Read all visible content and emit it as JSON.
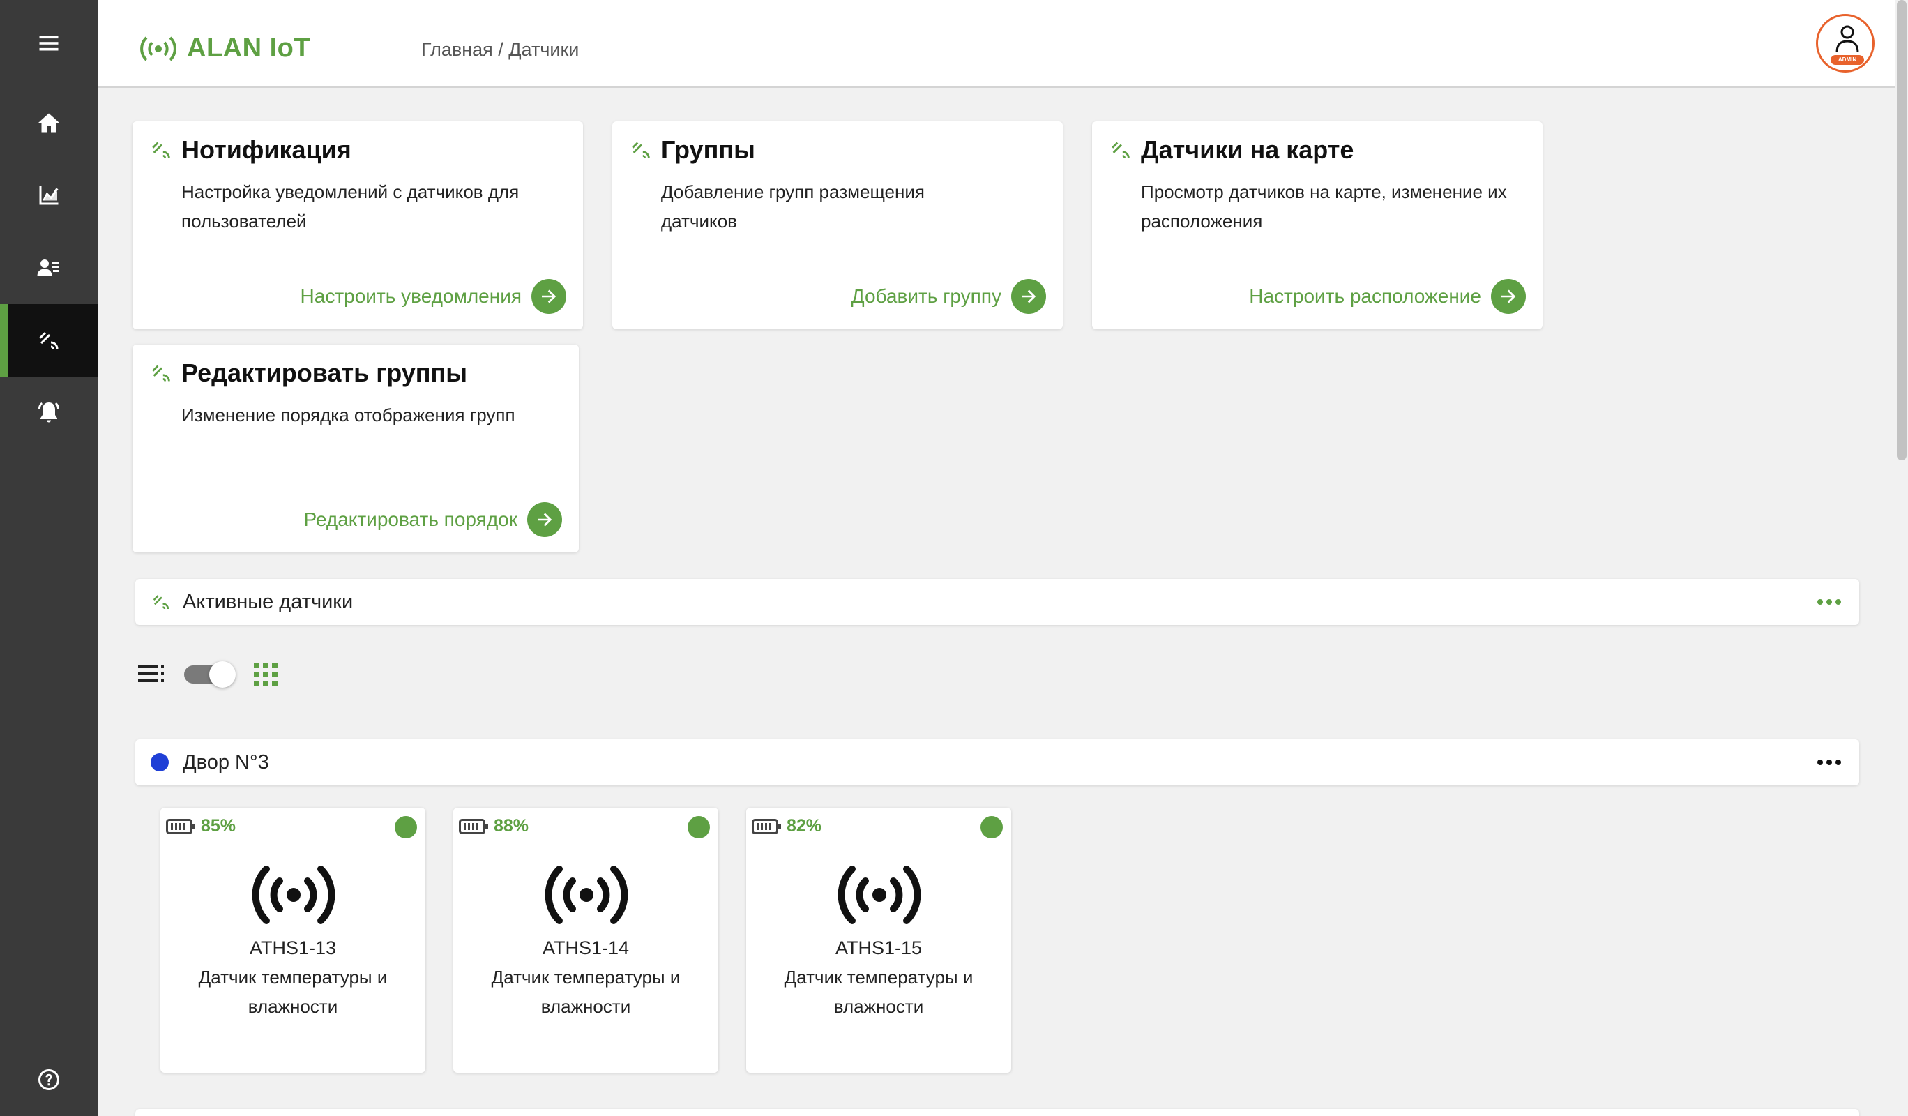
{
  "colors": {
    "accent": "#5ea043",
    "sidebar": "#3a3a3a",
    "sidebar_active": "#111111",
    "avatar_border": "#e8622c",
    "group_dot": "#1f3fd6",
    "status_online": "#5ea043"
  },
  "header": {
    "brand": "ALAN IoT",
    "breadcrumb": "Главная / Датчики",
    "avatar_badge": "ADMIN"
  },
  "sidebar": {
    "items": [
      {
        "icon": "menu-icon"
      },
      {
        "icon": "home-icon"
      },
      {
        "icon": "chart-icon"
      },
      {
        "icon": "users-icon"
      },
      {
        "icon": "sensors-icon",
        "active": true
      },
      {
        "icon": "bell-icon"
      },
      {
        "icon": "help-icon"
      }
    ]
  },
  "cards": [
    {
      "title": "Нотификация",
      "desc": "Настройка уведомлений с датчиков для пользователей",
      "action": "Настроить уведомления"
    },
    {
      "title": "Группы",
      "desc": "Добавление групп размещения датчиков",
      "action": "Добавить группу"
    },
    {
      "title": "Датчики на карте",
      "desc": "Просмотр датчиков на карте, изменение их расположения",
      "action": "Настроить расположение"
    },
    {
      "title": "Редактировать группы",
      "desc": "Изменение порядка отображения групп",
      "action": "Редактировать порядок"
    }
  ],
  "active_bar": {
    "title": "Активные датчики"
  },
  "view_toggle": {
    "mode": "grid"
  },
  "group": {
    "title": "Двор N°3"
  },
  "sensors": [
    {
      "battery": "85%",
      "name": "ATHS1-13",
      "desc": "Датчик температуры и влажности",
      "online": true
    },
    {
      "battery": "88%",
      "name": "ATHS1-14",
      "desc": "Датчик температуры и влажности",
      "online": true
    },
    {
      "battery": "82%",
      "name": "ATHS1-15",
      "desc": "Датчик температуры и влажности",
      "online": true
    }
  ]
}
